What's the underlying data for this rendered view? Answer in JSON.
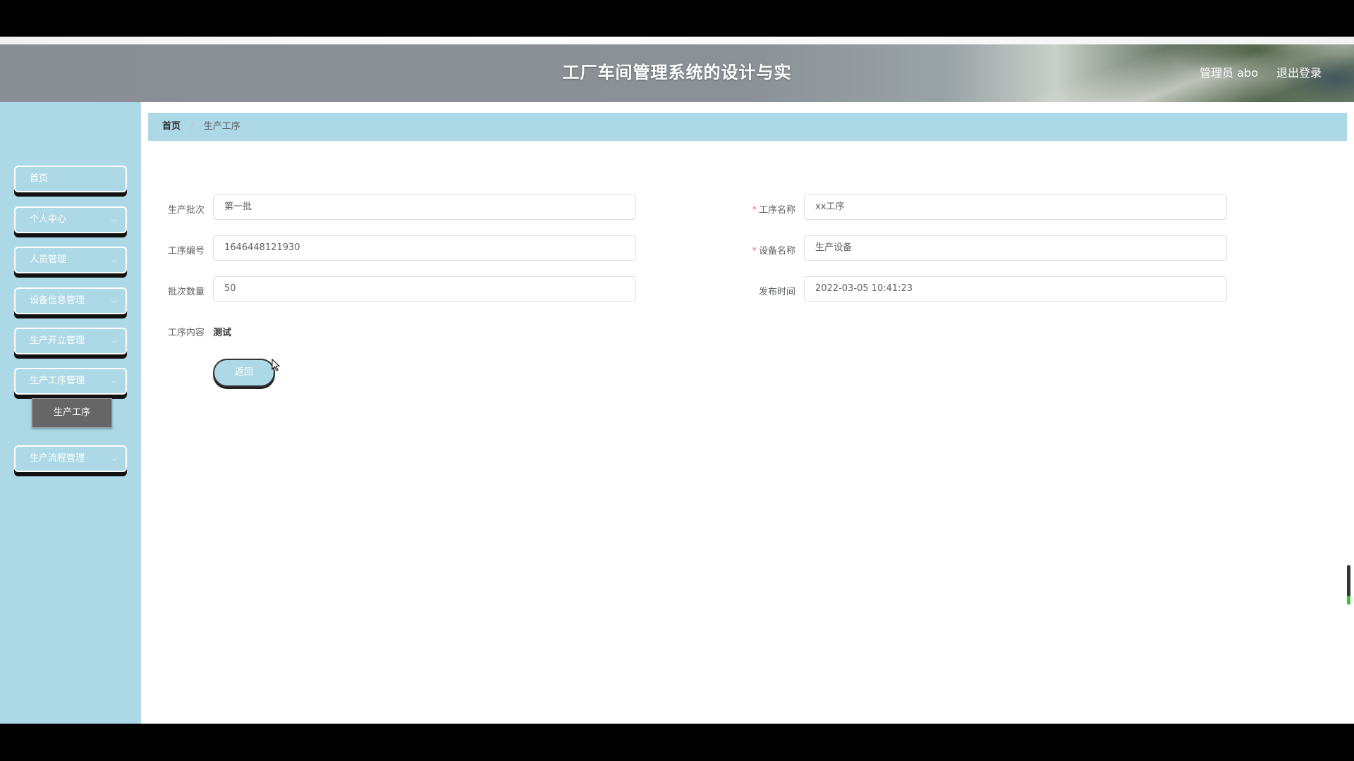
{
  "header": {
    "title": "工厂车间管理系统的设计与实",
    "user_label": "管理员 abo",
    "logout_label": "退出登录"
  },
  "sidebar": {
    "items": [
      {
        "label": "首页",
        "has_children": false
      },
      {
        "label": "个人中心",
        "has_children": true
      },
      {
        "label": "人员管理",
        "has_children": true
      },
      {
        "label": "设备信息管理",
        "has_children": true
      },
      {
        "label": "生产开立管理",
        "has_children": true
      },
      {
        "label": "生产工序管理",
        "has_children": true
      },
      {
        "label": "生产流程管理",
        "has_children": true
      }
    ],
    "active_sub_item": "生产工序",
    "chevron": "⌵"
  },
  "breadcrumb": {
    "home": "首页",
    "separator": "/",
    "current": "生产工序"
  },
  "form": {
    "batch_label": "生产批次",
    "batch_value": "第一批",
    "process_name_label": "工序名称",
    "process_name_value": "xx工序",
    "process_no_label": "工序编号",
    "process_no_value": "1646448121930",
    "device_name_label": "设备名称",
    "device_name_value": "生产设备",
    "batch_qty_label": "批次数量",
    "batch_qty_value": "50",
    "publish_time_label": "发布时间",
    "publish_time_value": "2022-03-05 10:41:23",
    "content_label": "工序内容",
    "content_value": "测试",
    "required_mark": "*",
    "back_label": "返回"
  },
  "colors": {
    "accent": "#add8e6",
    "required": "#f56c6c",
    "submenu_bg": "#666666"
  }
}
